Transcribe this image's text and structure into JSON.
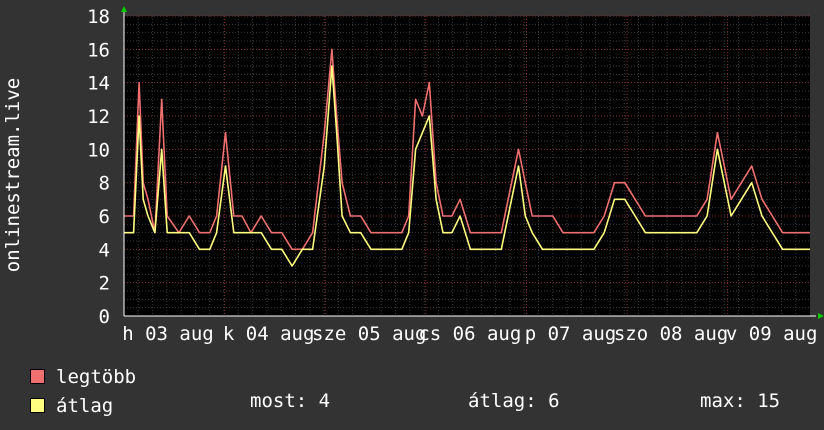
{
  "chart_data": {
    "type": "line",
    "ylabel": "onlinestream.live",
    "ylim": [
      0,
      18
    ],
    "yticks": [
      0,
      2,
      4,
      6,
      8,
      10,
      12,
      14,
      16,
      18
    ],
    "grid": true,
    "legend_position": "bottom-left",
    "xticks": [
      {
        "label": "h 03 aug",
        "pos": 0.0
      },
      {
        "label": "k 04 aug",
        "pos": 0.1467
      },
      {
        "label": "sze 05 aug",
        "pos": 0.2933
      },
      {
        "label": "cs 06 aug",
        "pos": 0.44
      },
      {
        "label": "p 07 aug",
        "pos": 0.5867
      },
      {
        "label": "szo 08 aug",
        "pos": 0.7333
      },
      {
        "label": "v 09 aug",
        "pos": 0.88
      }
    ],
    "x_range": [
      0,
      1
    ],
    "series": [
      {
        "name": "legtöbb",
        "color": "#f07070",
        "points": [
          [
            0,
            6
          ],
          [
            0.014,
            6
          ],
          [
            0.022,
            14
          ],
          [
            0.028,
            8
          ],
          [
            0.035,
            7
          ],
          [
            0.045,
            5
          ],
          [
            0.055,
            13
          ],
          [
            0.063,
            6
          ],
          [
            0.08,
            5
          ],
          [
            0.095,
            6
          ],
          [
            0.11,
            5
          ],
          [
            0.125,
            5
          ],
          [
            0.135,
            6
          ],
          [
            0.148,
            11
          ],
          [
            0.16,
            6
          ],
          [
            0.172,
            6
          ],
          [
            0.185,
            5
          ],
          [
            0.2,
            6
          ],
          [
            0.215,
            5
          ],
          [
            0.23,
            5
          ],
          [
            0.245,
            4
          ],
          [
            0.26,
            4
          ],
          [
            0.275,
            5
          ],
          [
            0.292,
            11
          ],
          [
            0.303,
            16
          ],
          [
            0.31,
            12
          ],
          [
            0.318,
            8
          ],
          [
            0.33,
            6
          ],
          [
            0.345,
            6
          ],
          [
            0.36,
            5
          ],
          [
            0.375,
            5
          ],
          [
            0.39,
            5
          ],
          [
            0.405,
            5
          ],
          [
            0.415,
            6
          ],
          [
            0.425,
            13
          ],
          [
            0.435,
            12
          ],
          [
            0.445,
            14
          ],
          [
            0.455,
            8
          ],
          [
            0.465,
            6
          ],
          [
            0.478,
            6
          ],
          [
            0.49,
            7
          ],
          [
            0.505,
            5
          ],
          [
            0.52,
            5
          ],
          [
            0.535,
            5
          ],
          [
            0.55,
            5
          ],
          [
            0.565,
            8
          ],
          [
            0.575,
            10
          ],
          [
            0.585,
            8
          ],
          [
            0.595,
            6
          ],
          [
            0.61,
            6
          ],
          [
            0.625,
            6
          ],
          [
            0.64,
            5
          ],
          [
            0.655,
            5
          ],
          [
            0.67,
            5
          ],
          [
            0.685,
            5
          ],
          [
            0.7,
            6
          ],
          [
            0.715,
            8
          ],
          [
            0.73,
            8
          ],
          [
            0.745,
            7
          ],
          [
            0.76,
            6
          ],
          [
            0.775,
            6
          ],
          [
            0.79,
            6
          ],
          [
            0.805,
            6
          ],
          [
            0.82,
            6
          ],
          [
            0.835,
            6
          ],
          [
            0.85,
            7
          ],
          [
            0.865,
            11
          ],
          [
            0.875,
            9
          ],
          [
            0.885,
            7
          ],
          [
            0.9,
            8
          ],
          [
            0.915,
            9
          ],
          [
            0.93,
            7
          ],
          [
            0.945,
            6
          ],
          [
            0.96,
            5
          ],
          [
            0.975,
            5
          ],
          [
            1,
            5
          ]
        ]
      },
      {
        "name": "átlag",
        "color": "#ffff80",
        "points": [
          [
            0,
            5
          ],
          [
            0.014,
            5
          ],
          [
            0.022,
            12
          ],
          [
            0.028,
            7
          ],
          [
            0.035,
            6
          ],
          [
            0.045,
            5
          ],
          [
            0.055,
            10
          ],
          [
            0.063,
            5
          ],
          [
            0.08,
            5
          ],
          [
            0.095,
            5
          ],
          [
            0.11,
            4
          ],
          [
            0.125,
            4
          ],
          [
            0.135,
            5
          ],
          [
            0.148,
            9
          ],
          [
            0.16,
            5
          ],
          [
            0.172,
            5
          ],
          [
            0.185,
            5
          ],
          [
            0.2,
            5
          ],
          [
            0.215,
            4
          ],
          [
            0.23,
            4
          ],
          [
            0.245,
            3
          ],
          [
            0.26,
            4
          ],
          [
            0.275,
            4
          ],
          [
            0.292,
            9
          ],
          [
            0.303,
            15
          ],
          [
            0.31,
            11
          ],
          [
            0.318,
            6
          ],
          [
            0.33,
            5
          ],
          [
            0.345,
            5
          ],
          [
            0.36,
            4
          ],
          [
            0.375,
            4
          ],
          [
            0.39,
            4
          ],
          [
            0.405,
            4
          ],
          [
            0.415,
            5
          ],
          [
            0.425,
            10
          ],
          [
            0.435,
            11
          ],
          [
            0.445,
            12
          ],
          [
            0.455,
            7
          ],
          [
            0.465,
            5
          ],
          [
            0.478,
            5
          ],
          [
            0.49,
            6
          ],
          [
            0.505,
            4
          ],
          [
            0.52,
            4
          ],
          [
            0.535,
            4
          ],
          [
            0.55,
            4
          ],
          [
            0.565,
            7
          ],
          [
            0.575,
            9
          ],
          [
            0.585,
            6
          ],
          [
            0.595,
            5
          ],
          [
            0.61,
            4
          ],
          [
            0.625,
            4
          ],
          [
            0.64,
            4
          ],
          [
            0.655,
            4
          ],
          [
            0.67,
            4
          ],
          [
            0.685,
            4
          ],
          [
            0.7,
            5
          ],
          [
            0.715,
            7
          ],
          [
            0.73,
            7
          ],
          [
            0.745,
            6
          ],
          [
            0.76,
            5
          ],
          [
            0.775,
            5
          ],
          [
            0.79,
            5
          ],
          [
            0.805,
            5
          ],
          [
            0.82,
            5
          ],
          [
            0.835,
            5
          ],
          [
            0.85,
            6
          ],
          [
            0.865,
            10
          ],
          [
            0.875,
            8
          ],
          [
            0.885,
            6
          ],
          [
            0.9,
            7
          ],
          [
            0.915,
            8
          ],
          [
            0.93,
            6
          ],
          [
            0.945,
            5
          ],
          [
            0.96,
            4
          ],
          [
            0.975,
            4
          ],
          [
            1,
            4
          ]
        ]
      }
    ]
  },
  "legend": {
    "items": [
      {
        "label": "legtöbb",
        "color": "#f07070"
      },
      {
        "label": "átlag",
        "color": "#ffff80"
      }
    ]
  },
  "stats": {
    "now": "most: 4",
    "avg": "átlag: 6",
    "max": "max: 15"
  }
}
